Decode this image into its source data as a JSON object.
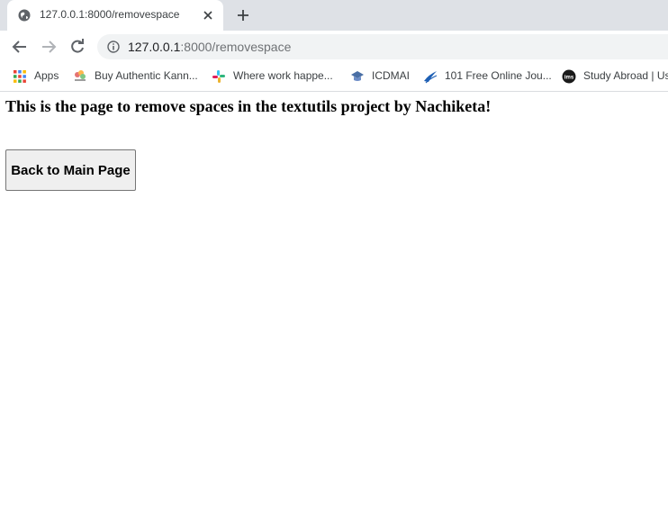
{
  "browser": {
    "tab": {
      "title": "127.0.0.1:8000/removespace"
    },
    "address": {
      "host": "127.0.0.1",
      "rest": ":8000/removespace"
    },
    "bookmarks": [
      {
        "label": "Apps",
        "icon": "apps-grid-icon"
      },
      {
        "label": "Buy Authentic Kann...",
        "icon": "colorful-logo-icon"
      },
      {
        "label": "Where work happe...",
        "icon": "slack-icon"
      },
      {
        "label": "ICDMAI",
        "icon": "graduation-cap-icon"
      },
      {
        "label": "101 Free Online Jou...",
        "icon": "swoosh-icon"
      },
      {
        "label": "Study Abroad | Us",
        "icon": "ims-icon"
      }
    ]
  },
  "page": {
    "heading": "This is the page to remove spaces in the textutils project by Nachiketa!",
    "back_button_label": "Back to Main Page"
  },
  "colors": {
    "tabstrip": "#dee1e6",
    "omnibox": "#f1f3f4",
    "button_bg": "#efefef",
    "button_border": "#767676"
  }
}
